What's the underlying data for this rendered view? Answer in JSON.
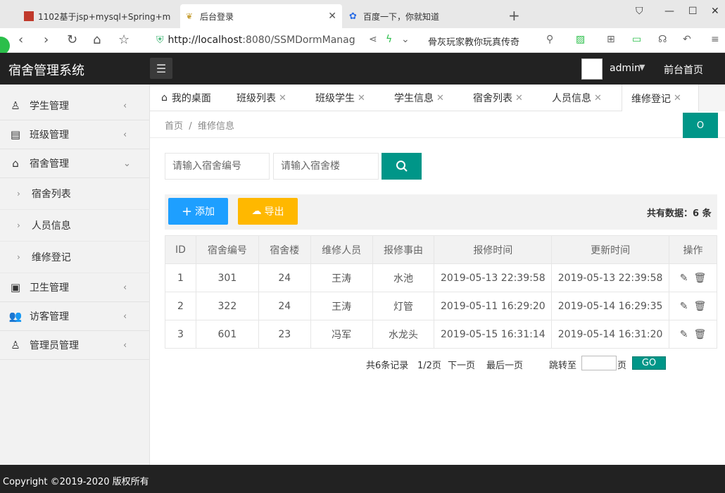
{
  "browser": {
    "tabs": [
      {
        "title": "1102基于jsp+mysql+Spring+m",
        "active": false
      },
      {
        "title": "后台登录",
        "active": true
      },
      {
        "title": "百度一下，你就知道",
        "active": false
      }
    ],
    "new_tab": "+",
    "url_host": "http://localhost",
    "url_rest": ":8080/SSMDormManag",
    "search_hint": "骨灰玩家教你玩真传奇"
  },
  "app": {
    "title": "宿舍管理系统",
    "user": "admin",
    "home_link": "前台首页"
  },
  "sidebar": {
    "items": [
      {
        "label": "学生管理",
        "icon": "user-icon",
        "glyph": "♙"
      },
      {
        "label": "班级管理",
        "icon": "document-icon",
        "glyph": "▤"
      },
      {
        "label": "宿舍管理",
        "icon": "inbox-icon",
        "glyph": "⌂"
      },
      {
        "label": "卫生管理",
        "icon": "clipboard-icon",
        "glyph": "▣"
      },
      {
        "label": "访客管理",
        "icon": "users-icon",
        "glyph": "👥"
      },
      {
        "label": "管理员管理",
        "icon": "admin-user-icon",
        "glyph": "♙"
      }
    ],
    "sub_items": [
      "宿舍列表",
      "人员信息",
      "维修登记"
    ]
  },
  "tabs": [
    {
      "label": "我的桌面"
    },
    {
      "label": "班级列表"
    },
    {
      "label": "班级学生"
    },
    {
      "label": "学生信息"
    },
    {
      "label": "宿舍列表"
    },
    {
      "label": "人员信息"
    },
    {
      "label": "维修登记"
    }
  ],
  "breadcrumb": {
    "home": "首页",
    "sep": "/",
    "current": "维修信息"
  },
  "refresh_label": "O",
  "search": {
    "dorm_no_placeholder": "请输入宿舍编号",
    "building_placeholder": "请输入宿舍楼"
  },
  "toolbar": {
    "add_label": "添加",
    "export_label": "导出",
    "total_text": "共有数据：6 条"
  },
  "table": {
    "headers": [
      "ID",
      "宿舍编号",
      "宿舍楼",
      "维修人员",
      "报修事由",
      "报修时间",
      "更新时间",
      "操作"
    ],
    "rows": [
      [
        "1",
        "301",
        "24",
        "王涛",
        "水池",
        "2019-05-13 22:39:58",
        "2019-05-13 22:39:58"
      ],
      [
        "2",
        "322",
        "24",
        "王涛",
        "灯管",
        "2019-05-11 16:29:20",
        "2019-05-14 16:29:35"
      ],
      [
        "3",
        "601",
        "23",
        "冯军",
        "水龙头",
        "2019-05-15 16:31:14",
        "2019-05-14 16:31:20"
      ]
    ]
  },
  "pager": {
    "records": "共6条记录",
    "pages": "1/2页",
    "next": "下一页",
    "last": "最后一页",
    "jump_to": "跳转至",
    "page_unit": "页",
    "go": "GO"
  },
  "footer": "Copyright ©2019-2020 版权所有"
}
